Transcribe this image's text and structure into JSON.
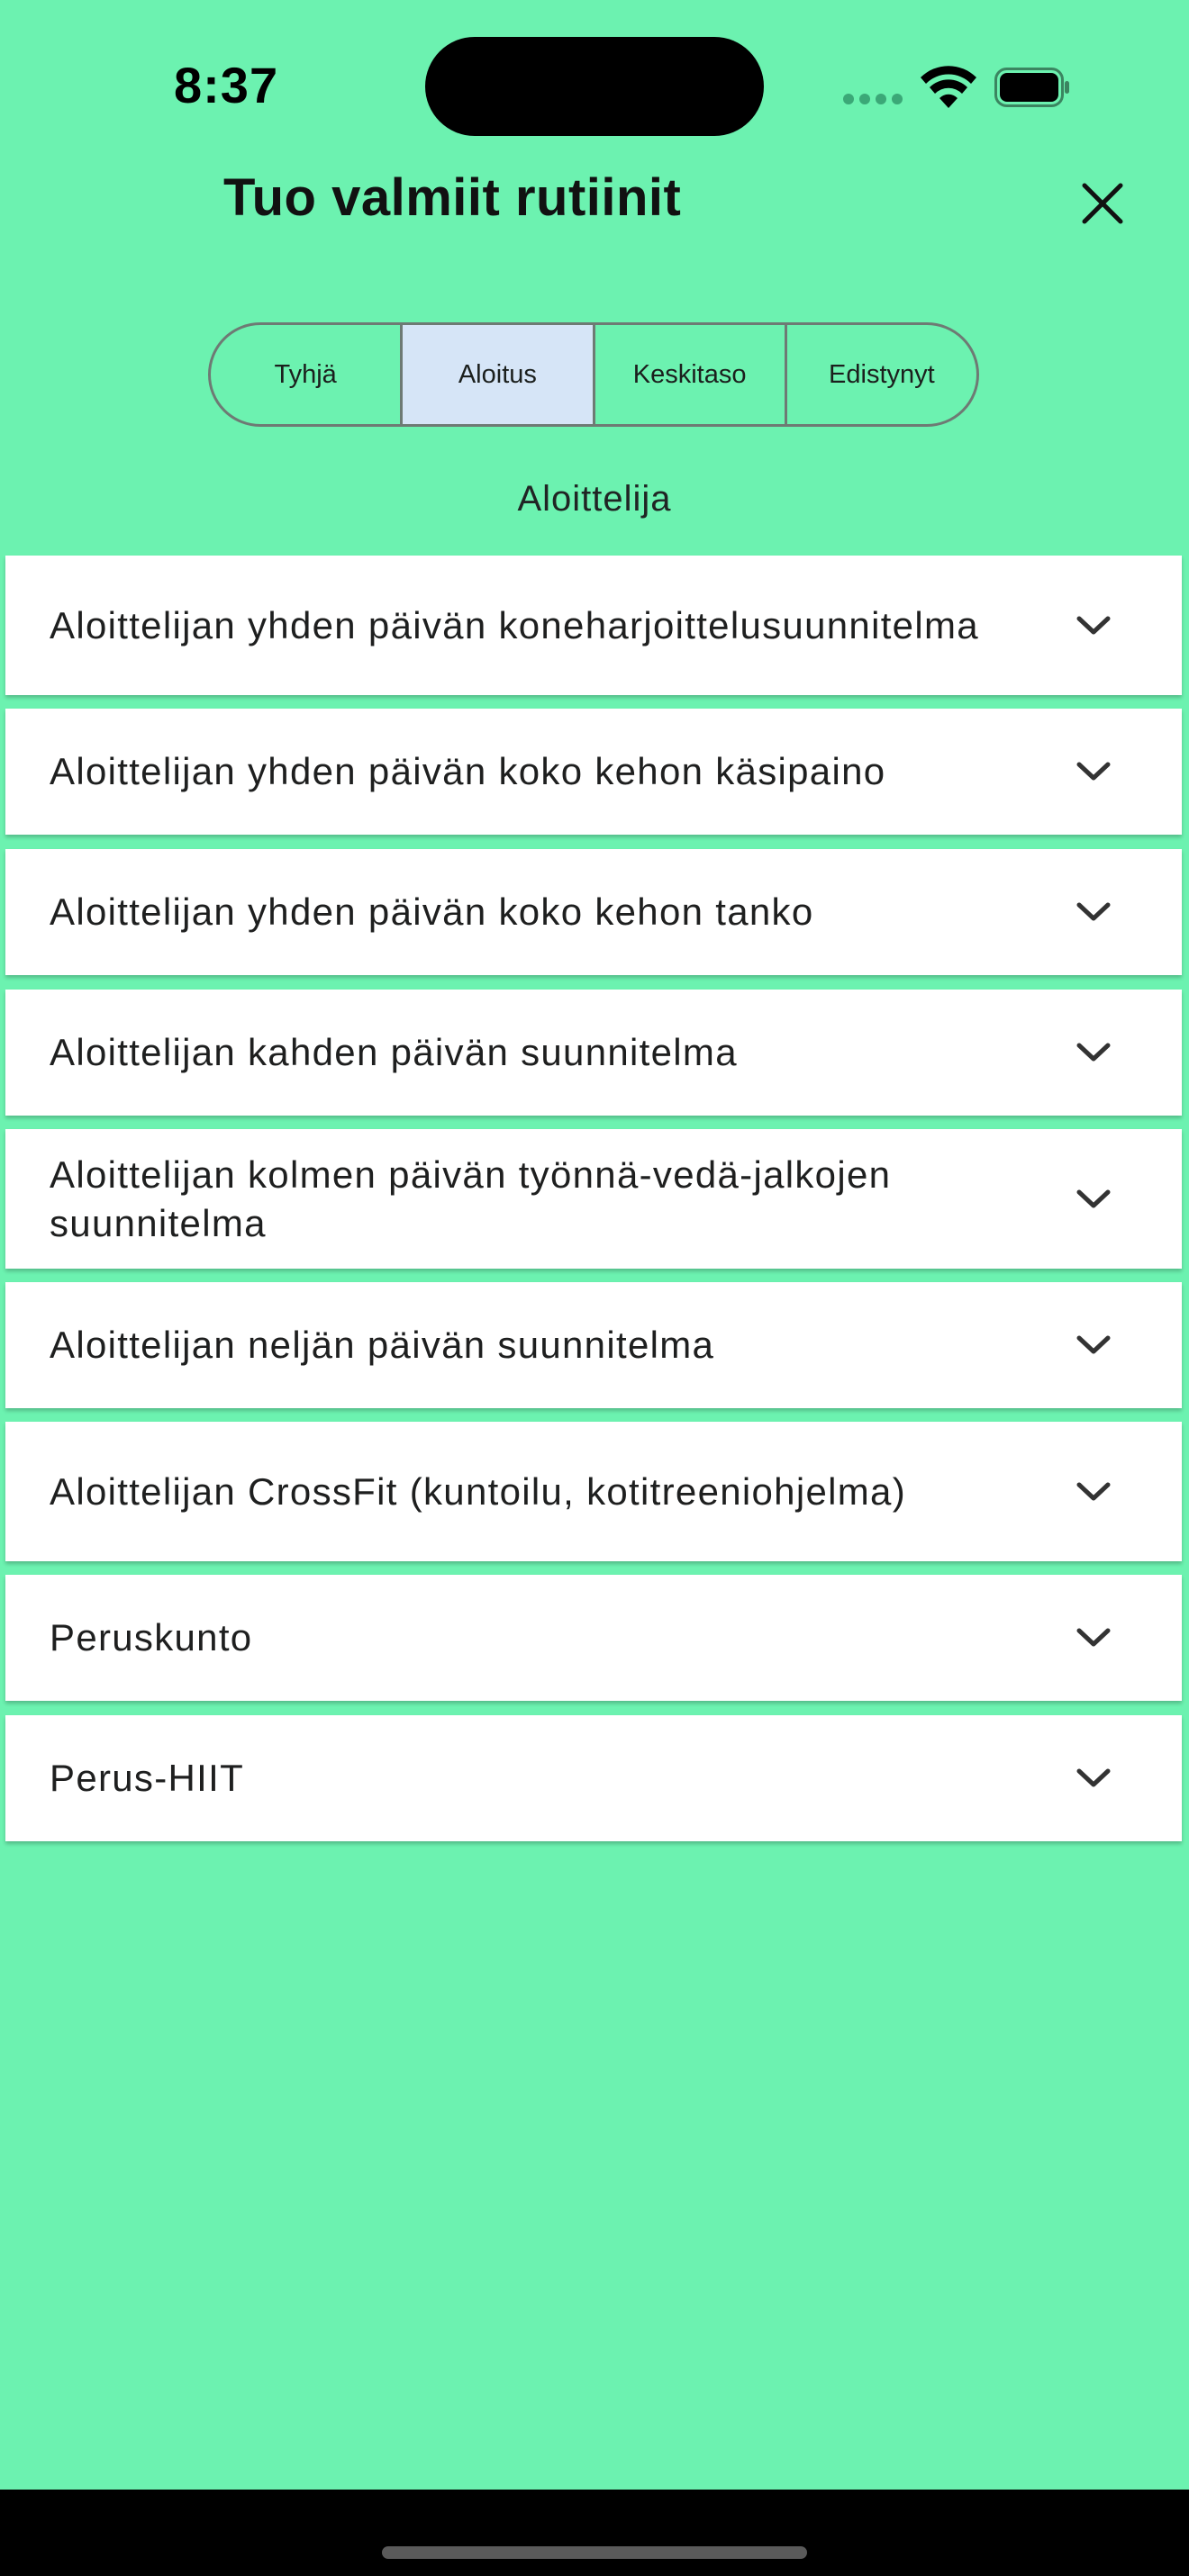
{
  "status_bar": {
    "time": "8:37",
    "icons": [
      "signal-icon",
      "wifi-icon",
      "battery-icon"
    ]
  },
  "header": {
    "title": "Tuo valmiit rutiinit",
    "close_icon": "close-icon"
  },
  "segments": {
    "items": [
      {
        "label": "Tyhjä",
        "selected": false
      },
      {
        "label": "Aloitus",
        "selected": true
      },
      {
        "label": "Keskitaso",
        "selected": false
      },
      {
        "label": "Edistynyt",
        "selected": false
      }
    ]
  },
  "section": {
    "heading": "Aloittelija"
  },
  "routines": {
    "items": [
      {
        "title": "Aloittelijan yhden päivän koneharjoittelusuunnitelma"
      },
      {
        "title": "Aloittelijan yhden päivän koko kehon käsipaino"
      },
      {
        "title": "Aloittelijan yhden päivän koko kehon tanko"
      },
      {
        "title": "Aloittelijan kahden päivän suunnitelma"
      },
      {
        "title": "Aloittelijan kolmen päivän työnnä-vedä-jalkojen suunnitelma"
      },
      {
        "title": "Aloittelijan neljän päivän suunnitelma"
      },
      {
        "title": "Aloittelijan CrossFit (kuntoilu, kotitreeniohjelma)"
      },
      {
        "title": "Peruskunto"
      },
      {
        "title": "Perus-HIIT"
      }
    ]
  },
  "colors": {
    "background": "#6cf2b0",
    "selected_segment": "#d6e5f7",
    "card": "#ffffff"
  }
}
